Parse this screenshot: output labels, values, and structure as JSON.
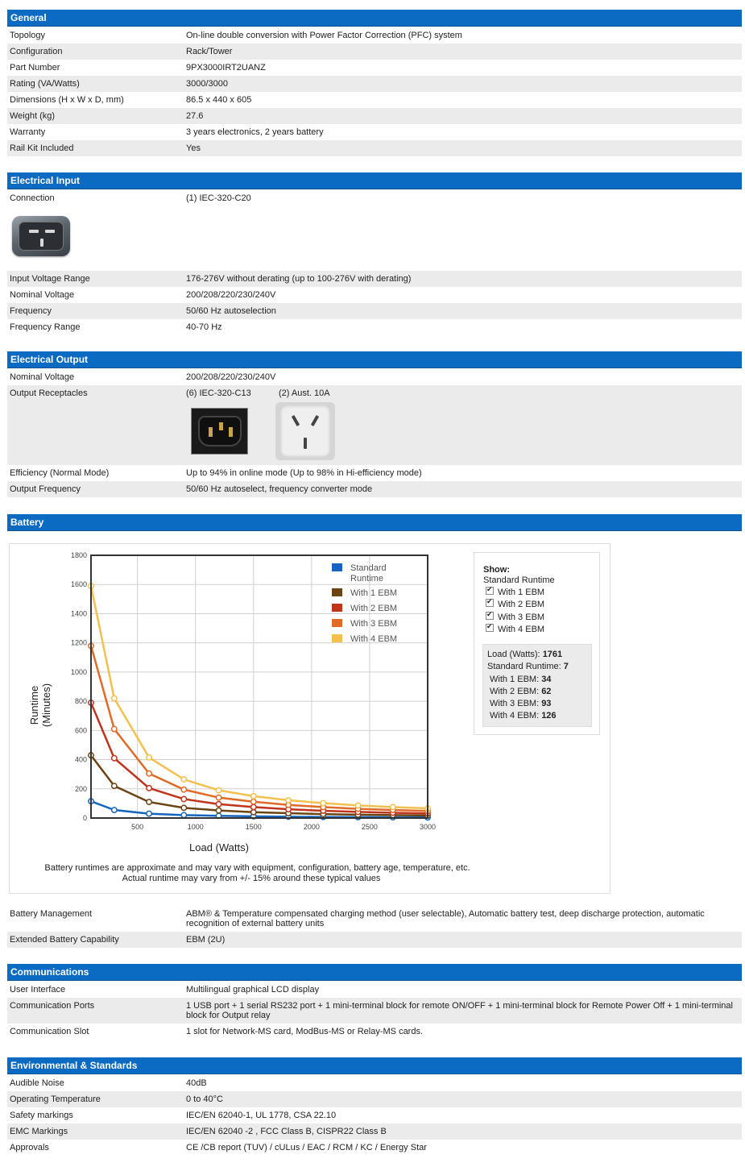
{
  "general": {
    "title": "General",
    "rows": [
      {
        "label": "Topology",
        "value": "On-line double conversion with Power Factor Correction (PFC) system"
      },
      {
        "label": "Configuration",
        "value": "Rack/Tower"
      },
      {
        "label": "Part Number",
        "value": "9PX3000IRT2UANZ"
      },
      {
        "label": "Rating (VA/Watts)",
        "value": "3000/3000"
      },
      {
        "label": "Dimensions (H x W x D, mm)",
        "value": "86.5 x 440 x 605"
      },
      {
        "label": "Weight (kg)",
        "value": "27.6"
      },
      {
        "label": "Warranty",
        "value": "3 years electronics, 2 years battery"
      },
      {
        "label": "Rail Kit Included",
        "value": "Yes"
      }
    ]
  },
  "electrical_input": {
    "title": "Electrical Input",
    "connection_label": "Connection",
    "connection_value": "(1) IEC-320-C20",
    "connection_icon": "iec-c20-plug",
    "rows": [
      {
        "label": "Input Voltage Range",
        "value": "176-276V without derating (up to 100-276V with derating)"
      },
      {
        "label": "Nominal Voltage",
        "value": "200/208/220/230/240V"
      },
      {
        "label": "Frequency",
        "value": "50/60 Hz autoselection"
      },
      {
        "label": "Frequency Range",
        "value": "40-70 Hz"
      }
    ]
  },
  "electrical_output": {
    "title": "Electrical Output",
    "nominal_label": "Nominal Voltage",
    "nominal_value": "200/208/220/230/240V",
    "receptacles_label": "Output Receptacles",
    "receptacles": [
      {
        "caption": "(6) IEC-320-C13",
        "icon": "iec-c13-socket"
      },
      {
        "caption": "(2) Aust. 10A",
        "icon": "aus-10a-socket"
      }
    ],
    "rows": [
      {
        "label": "Efficiency (Normal Mode)",
        "value": "Up to 94% in online mode (Up to 98% in Hi-efficiency mode)"
      },
      {
        "label": "Output Frequency",
        "value": "50/60 Hz autoselect, frequency converter mode"
      }
    ]
  },
  "battery": {
    "title": "Battery",
    "show_panel": {
      "title": "Show:",
      "standard": "Standard Runtime",
      "options": [
        "With 1 EBM",
        "With 2 EBM",
        "With 3 EBM",
        "With 4 EBM"
      ],
      "load_label": "Load (Watts):",
      "load_value": "1761",
      "readouts": [
        {
          "label": "Standard Runtime:",
          "value": "7"
        },
        {
          "label": "With 1 EBM:",
          "value": "34"
        },
        {
          "label": "With 2 EBM:",
          "value": "62"
        },
        {
          "label": "With 3 EBM:",
          "value": "93"
        },
        {
          "label": "With 4 EBM:",
          "value": "126"
        }
      ]
    },
    "note_line1": "Battery runtimes are approximate and may vary with equipment, configuration, battery age, temperature, etc.",
    "note_line2": "Actual runtime may vary from +/- 15% around these typical values",
    "rows": [
      {
        "label": "Battery Management",
        "value": "ABM® & Temperature compensated charging method (user selectable), Automatic battery test, deep discharge protection, automatic recognition of external battery units"
      },
      {
        "label": "Extended Battery Capability",
        "value": "EBM (2U)"
      }
    ]
  },
  "chart_data": {
    "type": "line",
    "xlabel": "Load (Watts)",
    "ylabel_line1": "Runtime",
    "ylabel_line2": "(Minutes)",
    "xlim": [
      100,
      3000
    ],
    "ylim": [
      0,
      1800
    ],
    "xticks": [
      500,
      1000,
      1500,
      2000,
      2500,
      3000
    ],
    "yticks": [
      0,
      200,
      400,
      600,
      800,
      1000,
      1200,
      1400,
      1600,
      1800
    ],
    "grid": true,
    "legend_position": "top-right",
    "x": [
      100,
      300,
      600,
      900,
      1200,
      1500,
      1800,
      2100,
      2400,
      2700,
      3000
    ],
    "series": [
      {
        "name": "Standard Runtime",
        "color": "#1565c0",
        "values": [
          115,
          55,
          30,
          20,
          15,
          12,
          9,
          7,
          6,
          5,
          4
        ]
      },
      {
        "name": "With 1 EBM",
        "color": "#6b4412",
        "values": [
          430,
          220,
          110,
          70,
          52,
          40,
          33,
          27,
          23,
          20,
          17
        ]
      },
      {
        "name": "With 2 EBM",
        "color": "#c0341c",
        "values": [
          790,
          410,
          205,
          130,
          95,
          75,
          60,
          50,
          42,
          36,
          32
        ]
      },
      {
        "name": "With 3 EBM",
        "color": "#e06a26",
        "values": [
          1180,
          610,
          305,
          195,
          140,
          112,
          90,
          75,
          63,
          55,
          48
        ]
      },
      {
        "name": "With 4 EBM",
        "color": "#f3c04e",
        "values": [
          1590,
          820,
          415,
          265,
          190,
          150,
          122,
          102,
          86,
          75,
          66
        ]
      }
    ]
  },
  "communications": {
    "title": "Communications",
    "rows": [
      {
        "label": "User Interface",
        "value": "Multilingual graphical LCD display"
      },
      {
        "label": "Communication Ports",
        "value": "1 USB port + 1 serial RS232 port + 1 mini-terminal block for remote ON/OFF + 1 mini-terminal block for Remote Power Off + 1 mini-terminal block for Output relay"
      },
      {
        "label": "Communication Slot",
        "value": "1 slot for Network-MS card, ModBus-MS or Relay-MS cards."
      }
    ]
  },
  "environmental": {
    "title": "Environmental & Standards",
    "rows": [
      {
        "label": "Audible Noise",
        "value": "40dB"
      },
      {
        "label": "Operating Temperature",
        "value": "0 to 40°C"
      },
      {
        "label": "Safety markings",
        "value": "IEC/EN 62040-1, UL 1778, CSA 22.10"
      },
      {
        "label": "EMC Markings",
        "value": "IEC/EN 62040 -2 , FCC Class B, CISPR22 Class B"
      },
      {
        "label": "Approvals",
        "value": "CE /CB report (TUV) / cULus / EAC / RCM / KC / Energy Star"
      }
    ]
  }
}
